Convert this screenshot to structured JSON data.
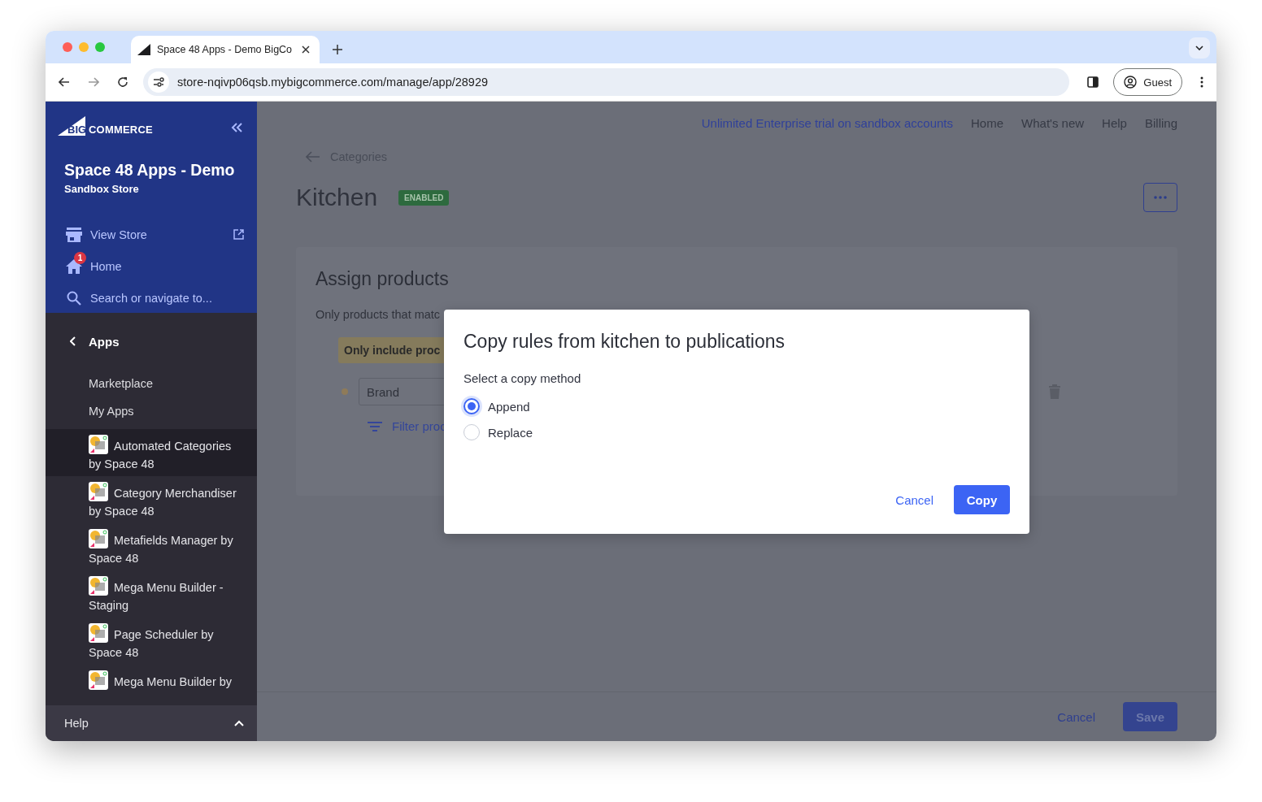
{
  "browser": {
    "tab_title": "Space 48 Apps - Demo BigCo",
    "url": "store-nqivp06qsb.mybigcommerce.com/manage/app/28929",
    "profile": "Guest"
  },
  "sidebar": {
    "logo": {
      "prefix": "BIG",
      "name": "COMMERCE"
    },
    "store_name": "Space 48 Apps - Demo",
    "store_type": "Sandbox Store",
    "nav": [
      {
        "kind": "store",
        "label": "View Store"
      },
      {
        "kind": "home",
        "label": "Home",
        "badge": "1"
      },
      {
        "kind": "search",
        "label": "Search or navigate to..."
      }
    ],
    "section": "Apps",
    "links": [
      "Marketplace",
      "My Apps"
    ],
    "apps": [
      {
        "label": "Automated Categories by Space 48",
        "selected": true
      },
      {
        "label": "Category Merchandiser by Space 48",
        "selected": false
      },
      {
        "label": "Metafields Manager by Space 48",
        "selected": false
      },
      {
        "label": "Mega Menu Builder - Staging",
        "selected": false
      },
      {
        "label": "Page Scheduler by Space 48",
        "selected": false
      },
      {
        "label": "Mega Menu Builder by",
        "selected": false
      }
    ],
    "help": "Help"
  },
  "header_links": [
    {
      "label": "Unlimited Enterprise trial on sandbox accounts",
      "kind": "promo"
    },
    {
      "label": "Home",
      "kind": "plain"
    },
    {
      "label": "What's new",
      "kind": "plain"
    },
    {
      "label": "Help",
      "kind": "plain"
    },
    {
      "label": "Billing",
      "kind": "plain"
    }
  ],
  "page": {
    "back": "Categories",
    "title": "Kitchen",
    "status": "ENABLED"
  },
  "card": {
    "title": "Assign products",
    "description": "Only products that matc",
    "rule": "Only include proc",
    "field": "Brand",
    "filter": "Filter proc"
  },
  "footer": {
    "cancel": "Cancel",
    "save": "Save"
  },
  "modal": {
    "title": "Copy rules from kitchen to publications",
    "prompt": "Select a copy method",
    "options": [
      {
        "label": "Append",
        "selected": true
      },
      {
        "label": "Replace",
        "selected": false
      }
    ],
    "cancel": "Cancel",
    "confirm": "Copy"
  }
}
